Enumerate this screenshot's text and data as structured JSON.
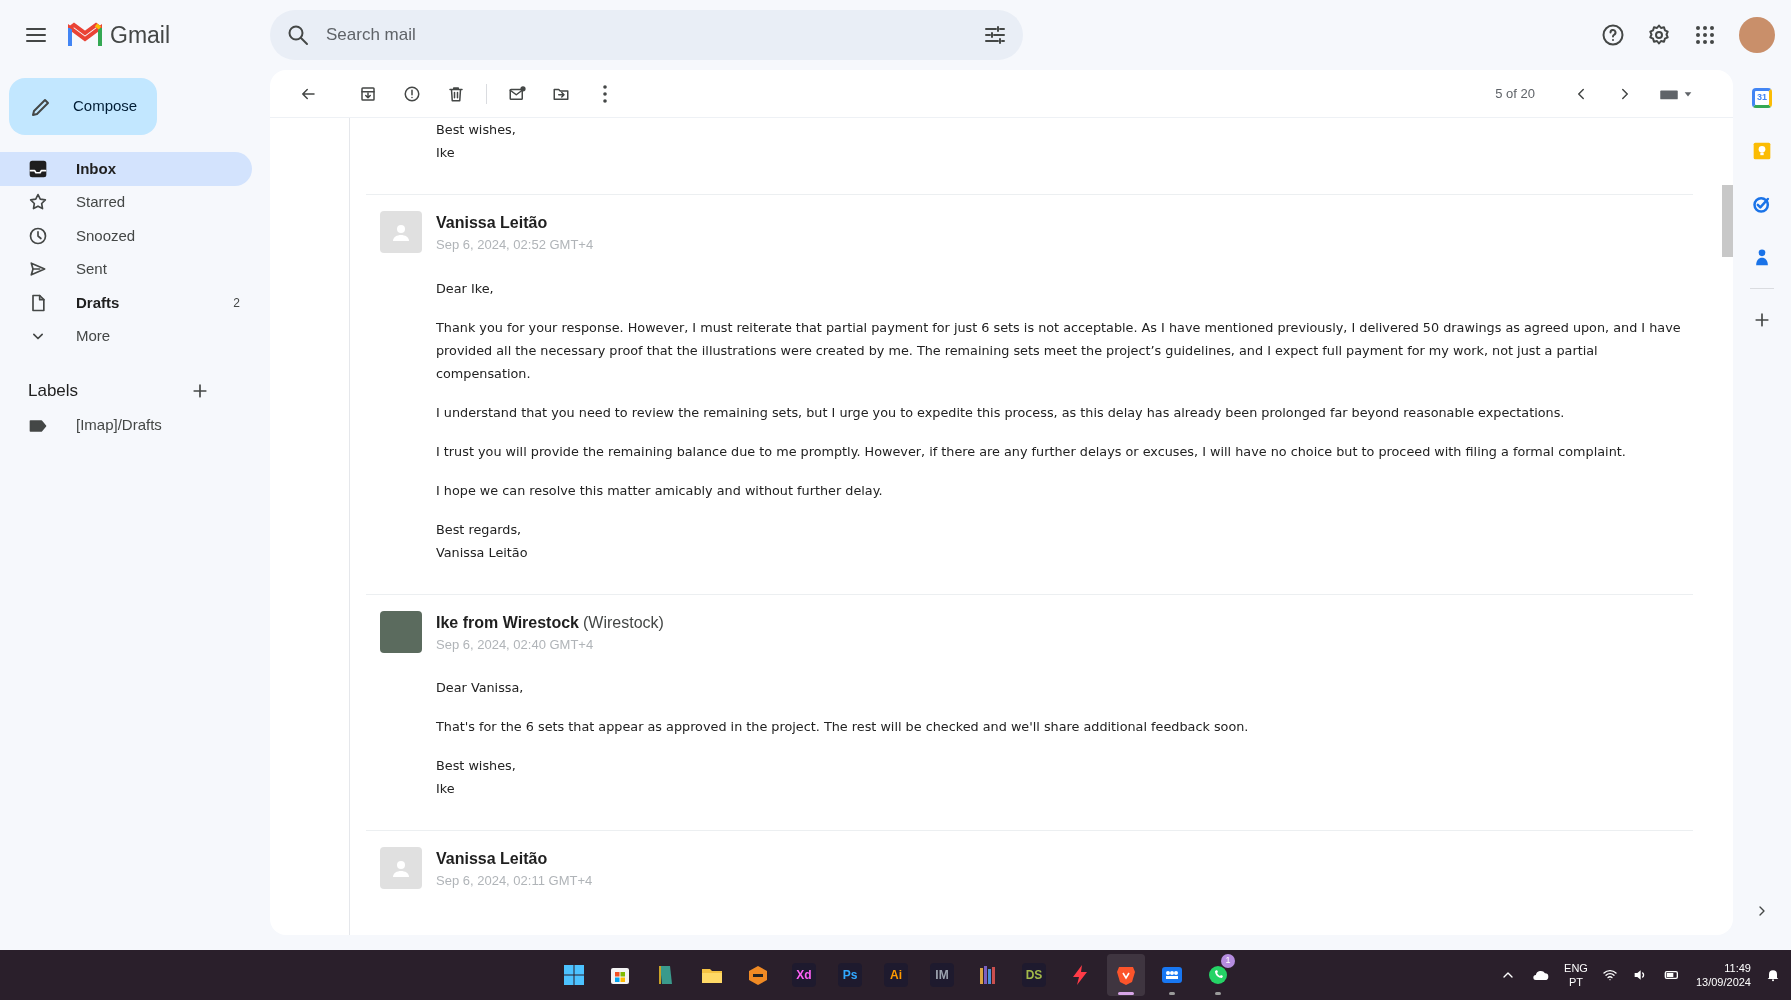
{
  "app": {
    "name": "Gmail"
  },
  "search": {
    "placeholder": "Search mail"
  },
  "compose": {
    "label": "Compose"
  },
  "nav": [
    {
      "label": "Inbox",
      "selected": true,
      "bold": true
    },
    {
      "label": "Starred",
      "selected": false,
      "bold": false
    },
    {
      "label": "Snoozed",
      "selected": false,
      "bold": false
    },
    {
      "label": "Sent",
      "selected": false,
      "bold": false
    },
    {
      "label": "Drafts",
      "count": "2",
      "selected": false,
      "bold": true
    },
    {
      "label": "More",
      "selected": false,
      "bold": false
    }
  ],
  "labels": {
    "title": "Labels",
    "items": [
      {
        "label": "[Imap]/Drafts"
      }
    ]
  },
  "toolbar": {
    "position": "5 of 20"
  },
  "messages": [
    {
      "kind": "tail",
      "body": [
        "Best wishes,\nIke"
      ]
    },
    {
      "kind": "full",
      "photo": false,
      "sender": "Vanissa Leitão",
      "date": "Sep 6, 2024, 02:52 GMT+4",
      "body": [
        "Dear Ike,",
        "Thank you for your response. However, I must reiterate that partial payment for just 6 sets is not acceptable. As I have mentioned previously, I delivered 50 drawings as agreed upon, and I have provided all the necessary proof that the illustrations were created by me. The remaining sets meet the project’s guidelines, and I expect full payment for my work, not just a partial compensation.",
        "I understand that you need to review the remaining sets, but I urge you to expedite this process, as this delay has already been prolonged far beyond reasonable expectations.",
        "I trust you will provide the remaining balance due to me promptly. However, if there are any further delays or excuses, I will have no choice but to proceed with filing a formal complaint.",
        "I hope we can resolve this matter amicably and without further delay.",
        "Best regards,\nVanissa Leitão"
      ]
    },
    {
      "kind": "full",
      "photo": true,
      "sender": "Ike from Wirestock",
      "sender_extra": "(Wirestock)",
      "date": "Sep 6, 2024, 02:40 GMT+4",
      "body": [
        "Dear Vanissa,",
        "That's for the 6 sets that appear as approved in the project. The rest will be checked and we'll share additional feedback soon.",
        "Best wishes,\nIke"
      ]
    },
    {
      "kind": "collapsed",
      "photo": false,
      "sender": "Vanissa Leitão",
      "date": "Sep 6, 2024, 02:11 GMT+4"
    }
  ],
  "side_panel": {
    "calendar_day": "31"
  },
  "taskbar": {
    "apps": [
      {
        "kind": "windows",
        "running": false,
        "selected": false
      },
      {
        "kind": "store",
        "running": false,
        "selected": false
      },
      {
        "kind": "book",
        "running": false,
        "selected": false
      },
      {
        "kind": "folder",
        "running": false,
        "selected": false
      },
      {
        "kind": "box",
        "running": false,
        "selected": false
      },
      {
        "kind": "text",
        "label": "Xd",
        "color": "#ff61f6",
        "running": false,
        "selected": false
      },
      {
        "kind": "text",
        "label": "Ps",
        "color": "#31a8ff",
        "running": false,
        "selected": false
      },
      {
        "kind": "text",
        "label": "Ai",
        "color": "#ff9a00",
        "running": false,
        "selected": false
      },
      {
        "kind": "text",
        "label": "IM",
        "color": "#9ca3af",
        "running": false,
        "selected": false
      },
      {
        "kind": "books",
        "running": false,
        "selected": false
      },
      {
        "kind": "text",
        "label": "DS",
        "color": "#a3b94a",
        "running": false,
        "selected": false
      },
      {
        "kind": "bolt",
        "running": false,
        "selected": false
      },
      {
        "kind": "lion",
        "running": true,
        "selected": true
      },
      {
        "kind": "people",
        "running": true,
        "selected": false
      },
      {
        "kind": "chat",
        "badge": "1",
        "running": true,
        "selected": false
      }
    ],
    "language": "ENG",
    "layout": "PT",
    "time": "11:49",
    "date": "13/09/2024"
  }
}
